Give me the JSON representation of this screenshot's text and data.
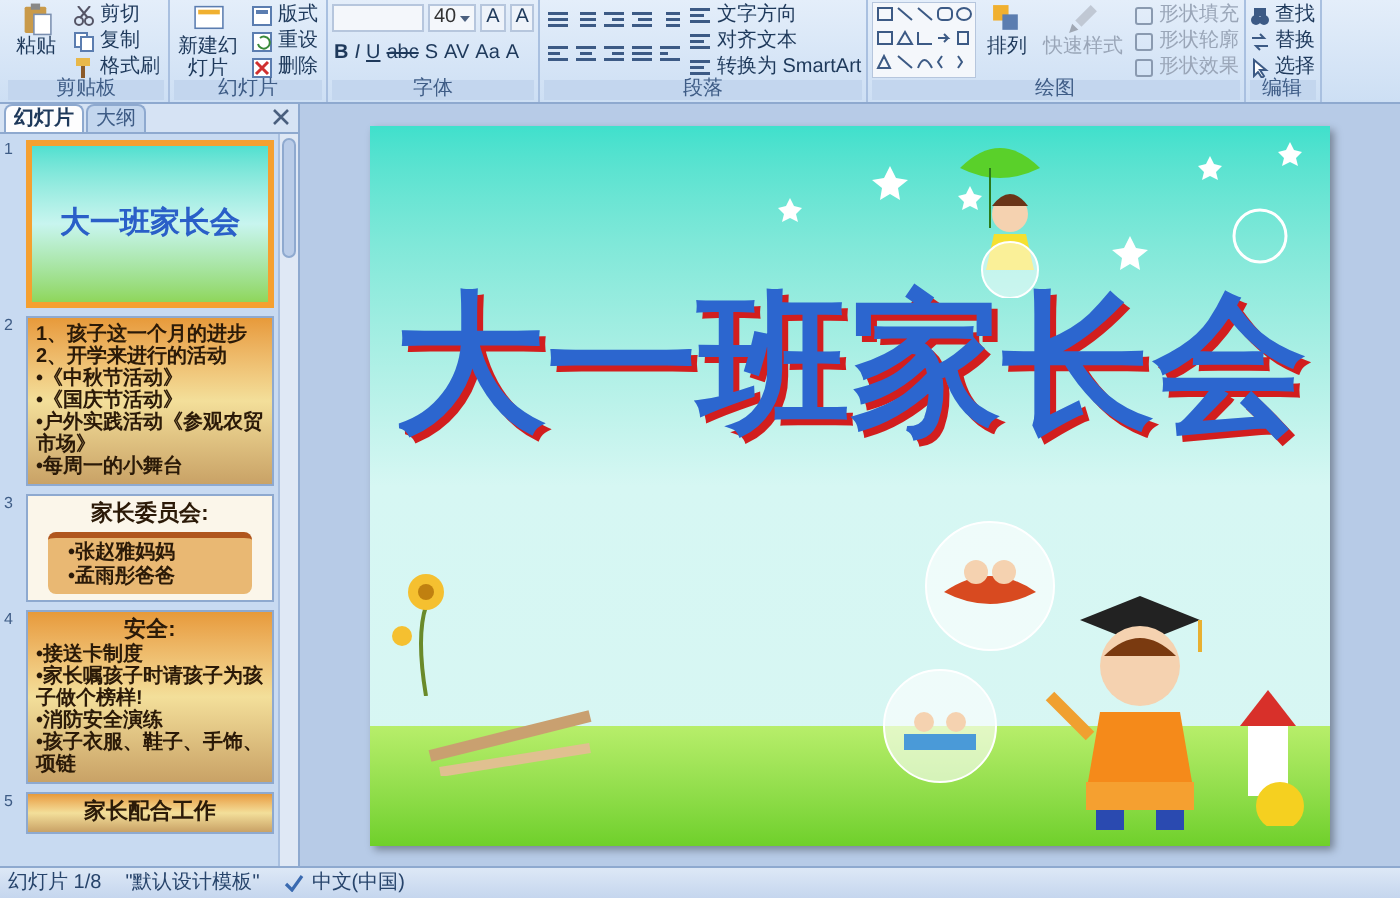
{
  "ribbon": {
    "groups": [
      {
        "kind": "clipboard",
        "label": "剪贴板",
        "big": {
          "label": "粘贴"
        },
        "small": [
          {
            "label": "剪切"
          },
          {
            "label": "复制"
          },
          {
            "label": "格式刷"
          }
        ]
      },
      {
        "kind": "slides",
        "label": "幻灯片",
        "big": {
          "label": "新建幻灯片"
        },
        "small": [
          {
            "label": "版式"
          },
          {
            "label": "重设"
          },
          {
            "label": "删除"
          }
        ]
      },
      {
        "kind": "font",
        "label": "字体",
        "font_size": "40",
        "size_buttons": [
          "A",
          "A"
        ],
        "format_buttons": [
          "B",
          "I",
          "U",
          "abc",
          "S",
          "AV",
          "Aa",
          "A"
        ]
      },
      {
        "kind": "paragraph",
        "label": "段落",
        "commands": [
          "文字方向",
          "对齐文本",
          "转换为 SmartArt"
        ]
      },
      {
        "kind": "drawing",
        "label": "绘图",
        "arrange": "排列",
        "quick_styles": {
          "label": "快速样式",
          "disabled": true
        },
        "shape_commands": [
          {
            "label": "形状填充",
            "disabled": true
          },
          {
            "label": "形状轮廓",
            "disabled": true
          },
          {
            "label": "形状效果",
            "disabled": true
          }
        ]
      },
      {
        "kind": "editing",
        "label": "编辑",
        "commands": [
          "查找",
          "替换",
          "选择"
        ]
      }
    ]
  },
  "panel": {
    "tabs": [
      {
        "label": "幻灯片",
        "selected": true
      },
      {
        "label": "大纲",
        "selected": false
      }
    ],
    "slides": [
      {
        "number": "1",
        "kind": "title",
        "selected": true,
        "lines": [
          "大一班家长会"
        ]
      },
      {
        "number": "2",
        "kind": "autumn",
        "selected": false,
        "lines": [
          "1、孩子这一个月的进步",
          "2、开学来进行的活动",
          "•《中秋节活动》",
          "•《国庆节活动》",
          "•户外实践活动《参观农贸市场》",
          "•每周一的小舞台"
        ]
      },
      {
        "number": "3",
        "kind": "parchment",
        "selected": false,
        "title": "家长委员会:",
        "lines": [
          "•张赵雅妈妈",
          "•孟雨彤爸爸"
        ]
      },
      {
        "number": "4",
        "kind": "autumn",
        "selected": false,
        "title": "安全:",
        "lines": [
          "•接送卡制度",
          "•家长嘱孩子时请孩子为孩子做个榜样!",
          "•消防安全演练",
          "•孩子衣服、鞋子、手饰、项链"
        ]
      },
      {
        "number": "5",
        "kind": "autumn",
        "selected": false,
        "title": "家长配合工作"
      }
    ]
  },
  "slide": {
    "title": "大一班家长会"
  },
  "status_bar": {
    "slide": "幻灯片 1/8",
    "theme": "\"默认设计模板\"",
    "language": "中文(中国)"
  }
}
